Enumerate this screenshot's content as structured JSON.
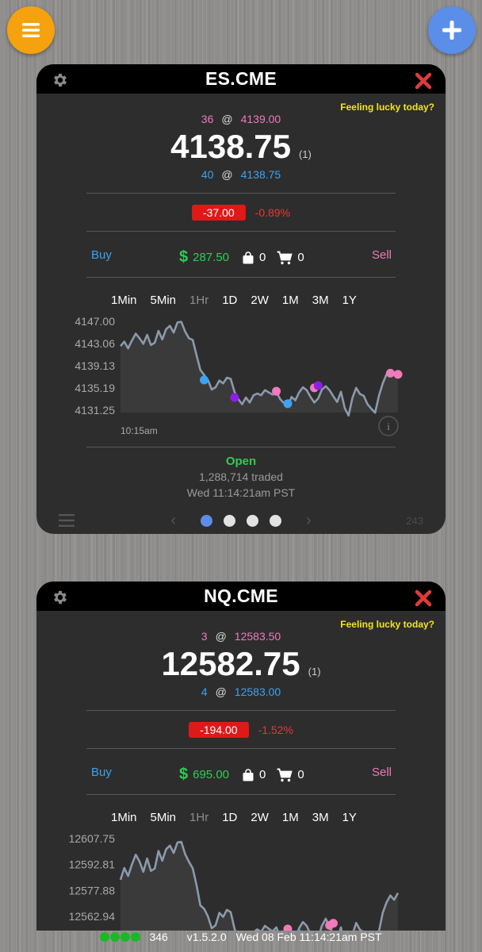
{
  "top_buttons": {
    "menu_icon": "hamburger-icon",
    "add_icon": "plus-icon"
  },
  "cards": [
    {
      "symbol": "ES.CME",
      "lucky": "Feeling lucky today?",
      "ask_size": "36",
      "ask_price": "4139.00",
      "last_price": "4138.75",
      "last_size": "(1)",
      "bid_size": "40",
      "bid_price": "4138.75",
      "at": "@",
      "change": "-37.00",
      "change_pct": "-0.89%",
      "buy": "Buy",
      "sell": "Sell",
      "cash": "287.50",
      "bag_count": "0",
      "cart_count": "0",
      "timeframes": [
        "1Min",
        "5Min",
        "1Hr",
        "1D",
        "2W",
        "1M",
        "3M",
        "1Y"
      ],
      "active_timeframe": "1Hr",
      "status": "Open",
      "traded": "1,288,714 traded",
      "timestamp": "Wed 11:14:21am PST",
      "footer_count": "243"
    },
    {
      "symbol": "NQ.CME",
      "lucky": "Feeling lucky today?",
      "ask_size": "3",
      "ask_price": "12583.50",
      "last_price": "12582.75",
      "last_size": "(1)",
      "bid_size": "4",
      "bid_price": "12583.00",
      "at": "@",
      "change": "-194.00",
      "change_pct": "-1.52%",
      "buy": "Buy",
      "sell": "Sell",
      "cash": "695.00",
      "bag_count": "0",
      "cart_count": "0",
      "timeframes": [
        "1Min",
        "5Min",
        "1Hr",
        "1D",
        "2W",
        "1M",
        "3M",
        "1Y"
      ],
      "active_timeframe": "1Hr"
    }
  ],
  "chart_data": [
    {
      "type": "area",
      "title": "",
      "ytick_labels": [
        "4147.00",
        "4143.06",
        "4139.13",
        "4135.19",
        "4131.25"
      ],
      "ylim": [
        4131.25,
        4147.0
      ],
      "xtick_labels": [
        "10:15am"
      ],
      "series": [
        {
          "values": [
            4142.6,
            4143.4,
            4142.2,
            4143.6,
            4144.8,
            4144.0,
            4143.0,
            4144.6,
            4142.8,
            4143.2,
            4145.3,
            4143.8,
            4145.6,
            4146.2,
            4145.0,
            4146.8,
            4146.9,
            4145.2,
            4144.0,
            4143.7,
            4141.0,
            4138.4,
            4137.5,
            4136.6,
            4134.9,
            4135.3,
            4136.5,
            4136.0,
            4137.0,
            4136.8,
            4134.5,
            4133.2,
            4132.3,
            4133.5,
            4132.6,
            4133.9,
            4134.2,
            4133.9,
            4134.8,
            4134.4,
            4134.0,
            4134.5,
            4133.2,
            4132.5,
            4131.9,
            4133.6,
            4133.0,
            4134.4,
            4135.3,
            4134.8,
            4133.6,
            4132.6,
            4133.3,
            4134.9,
            4135.5,
            4134.8,
            4133.7,
            4132.7,
            4134.5,
            4131.6,
            4130.3,
            4133.4,
            4135.2,
            4134.1,
            4133.8,
            4132.3,
            4131.5,
            4130.8,
            4133.8,
            4136.0,
            4137.6,
            4138.1,
            4137.5,
            4138.2
          ]
        }
      ],
      "markers": [
        {
          "index": 22,
          "value": 4136.6,
          "color": "#3da2f2"
        },
        {
          "index": 30,
          "value": 4133.5,
          "color": "#8f1ee6"
        },
        {
          "index": 41,
          "value": 4134.6,
          "color": "#f07abc"
        },
        {
          "index": 44,
          "value": 4132.4,
          "color": "#3da2f2"
        },
        {
          "index": 51,
          "value": 4135.2,
          "color": "#f07abc"
        },
        {
          "index": 52,
          "value": 4135.6,
          "color": "#8f1ee6"
        },
        {
          "index": 71,
          "value": 4137.8,
          "color": "#f07abc"
        },
        {
          "index": 73,
          "value": 4137.6,
          "color": "#f07abc"
        }
      ]
    },
    {
      "type": "area",
      "title": "",
      "ytick_labels": [
        "12607.75",
        "12592.81",
        "12577.88",
        "12562.94"
      ],
      "ylim": [
        12547.0,
        12607.75
      ],
      "series": [
        {
          "values": [
            12584.0,
            12590.8,
            12586.2,
            12592.8,
            12598.5,
            12594.6,
            12588.6,
            12596.3,
            12589.1,
            12590.5,
            12600.6,
            12595.0,
            12601.6,
            12603.7,
            12599.5,
            12605.5,
            12605.9,
            12598.8,
            12594.4,
            12590.6,
            12581.0,
            12569.3,
            12567.3,
            12562.9,
            12556.1,
            12557.8,
            12565.0,
            12562.6,
            12566.7,
            12565.4,
            12555.8,
            12550.8,
            12547.6,
            12552.0,
            12549.2,
            12553.9,
            12555.5,
            12554.0,
            12557.5,
            12555.8,
            12554.3,
            12556.6,
            12551.1,
            12548.7,
            12545.9,
            12552.6,
            12550.5,
            12556.1,
            12559.7,
            12557.5,
            12552.6,
            12548.2,
            12550.6,
            12557.6,
            12561.6,
            12557.0,
            12553.0,
            12549.5,
            12556.6,
            12545.5,
            12541.6,
            12552.4,
            12559.2,
            12555.2,
            12554.0,
            12547.5,
            12544.0,
            12541.5,
            12554.3,
            12565.0,
            12571.0,
            12575.0,
            12572.5,
            12576.4
          ]
        }
      ],
      "markers": [
        {
          "index": 44,
          "value": 12555.7,
          "color": "#f07abc"
        },
        {
          "index": 47,
          "value": 12552.7,
          "color": "#3da2f2"
        },
        {
          "index": 55,
          "value": 12557.8,
          "color": "#f07abc"
        },
        {
          "index": 56,
          "value": 12559.0,
          "color": "#f07abc"
        }
      ]
    }
  ],
  "footer": {
    "pager_dots": 4,
    "active_dot": 0,
    "status_dots": 4,
    "status_count": "346",
    "version": "v1.5.2.0",
    "datetime": "Wed 08 Feb 11:14:21am PST"
  },
  "colors": {
    "ask": "#f07abc",
    "bid": "#3da2f2",
    "up": "#2ecc52",
    "down": "#e11818",
    "accent_orange": "#f5a20e",
    "accent_blue": "#5b8ee8",
    "lucky": "#f2e51c"
  }
}
